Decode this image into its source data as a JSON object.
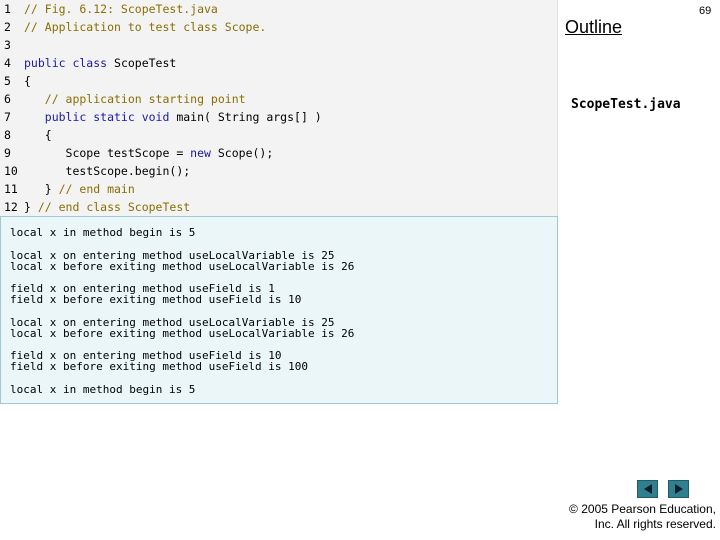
{
  "code": {
    "lines": [
      {
        "num": "1",
        "segments": [
          {
            "text": "// Fig. 6.12: ScopeTest.java",
            "style": "comment"
          }
        ]
      },
      {
        "num": "2",
        "segments": [
          {
            "text": "// Application to test class Scope.",
            "style": "comment"
          }
        ]
      },
      {
        "num": "3",
        "segments": []
      },
      {
        "num": "4",
        "segments": [
          {
            "text": "public class ",
            "style": "kw"
          },
          {
            "text": "ScopeTest",
            "style": "plain"
          }
        ]
      },
      {
        "num": "5",
        "segments": [
          {
            "text": "{",
            "style": "plain"
          }
        ]
      },
      {
        "num": "6",
        "segments": [
          {
            "text": "   // application starting point",
            "style": "comment"
          }
        ]
      },
      {
        "num": "7",
        "segments": [
          {
            "text": "   public static void ",
            "style": "kw"
          },
          {
            "text": "main( String args[] )",
            "style": "plain"
          }
        ]
      },
      {
        "num": "8",
        "segments": [
          {
            "text": "   {",
            "style": "plain"
          }
        ]
      },
      {
        "num": "9",
        "segments": [
          {
            "text": "      Scope testScope = ",
            "style": "plain"
          },
          {
            "text": "new ",
            "style": "kw"
          },
          {
            "text": "Scope();",
            "style": "plain"
          }
        ]
      },
      {
        "num": "10",
        "segments": [
          {
            "text": "      testScope.begin();",
            "style": "plain"
          }
        ]
      },
      {
        "num": "11",
        "segments": [
          {
            "text": "   } ",
            "style": "plain"
          },
          {
            "text": "// end main",
            "style": "comment"
          }
        ]
      },
      {
        "num": "12",
        "segments": [
          {
            "text": "} ",
            "style": "plain"
          },
          {
            "text": "// end class ScopeTest",
            "style": "comment"
          }
        ]
      }
    ]
  },
  "output": {
    "lines": [
      {
        "text": "local x in method begin is 5",
        "gap": false
      },
      {
        "text": "local x on entering method useLocalVariable is 25",
        "gap": true
      },
      {
        "text": "local x before exiting method useLocalVariable is 26",
        "gap": false
      },
      {
        "text": "field x on entering method useField is 1",
        "gap": true
      },
      {
        "text": "field x before exiting method useField is 10",
        "gap": false
      },
      {
        "text": "local x on entering method useLocalVariable is 25",
        "gap": true
      },
      {
        "text": "local x before exiting method useLocalVariable is 26",
        "gap": false
      },
      {
        "text": "field x on entering method useField is 10",
        "gap": true
      },
      {
        "text": "field x before exiting method useField is 100",
        "gap": false
      },
      {
        "text": "local x in method begin is 5",
        "gap": true
      }
    ]
  },
  "sidebar": {
    "outline_title": "Outline",
    "file_label": "ScopeTest.java"
  },
  "page_number": "69",
  "nav": {
    "prev_icon": "left-triangle-icon",
    "next_icon": "right-triangle-icon"
  },
  "footer": {
    "line1": "© 2005 Pearson Education,",
    "line2": "Inc.  All rights reserved."
  },
  "colors": {
    "comment": "#8b6d00",
    "keyword": "#1a1aa6",
    "code_bg": "#f3f3f3",
    "output_bg": "#eaf6f8",
    "nav_button": "#2f7f8f"
  }
}
